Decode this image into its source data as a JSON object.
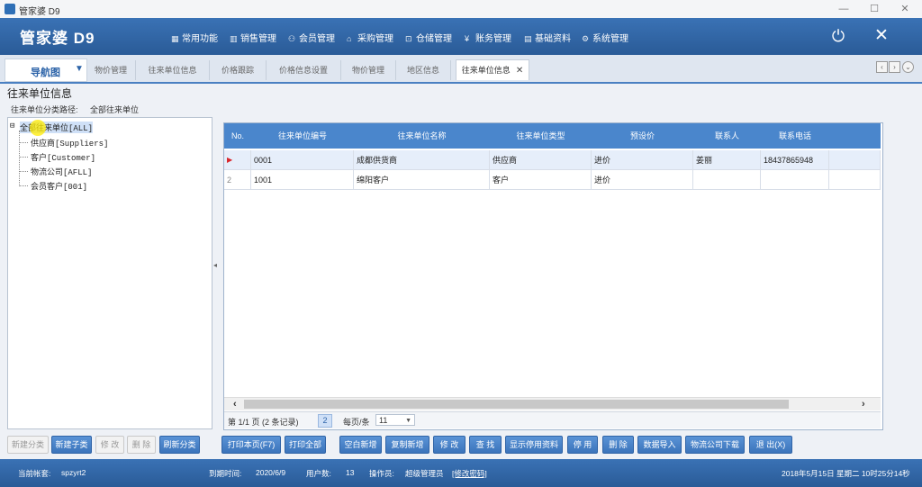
{
  "window": {
    "title": "管家婆 D9",
    "min": "—",
    "max": "☐",
    "close": "✕"
  },
  "header": {
    "logo": "管家婆 D9",
    "menu": [
      {
        "icon": "grid-icon",
        "glyph": "▦",
        "label": "常用功能"
      },
      {
        "icon": "chart-icon",
        "glyph": "▥",
        "label": "销售管理"
      },
      {
        "icon": "user-icon",
        "glyph": "⚇",
        "label": "会员管理"
      },
      {
        "icon": "home-icon",
        "glyph": "⌂",
        "label": "采购管理"
      },
      {
        "icon": "cart-icon",
        "glyph": "⊡",
        "label": "仓储管理"
      },
      {
        "icon": "yen-icon",
        "glyph": "¥",
        "label": "账务管理"
      },
      {
        "icon": "doc-icon",
        "glyph": "▤",
        "label": "基础资料"
      },
      {
        "icon": "gear-icon",
        "glyph": "⚙",
        "label": "系统管理"
      }
    ],
    "power_glyph": "⏻",
    "close_glyph": "✕"
  },
  "tabs": {
    "nav_label": "导航图",
    "items": [
      {
        "label": "物价管理"
      },
      {
        "label": "往来单位信息"
      },
      {
        "label": "价格跟踪"
      },
      {
        "label": "价格信息设置"
      },
      {
        "label": "物价管理"
      },
      {
        "label": "地区信息"
      },
      {
        "label": "往来单位信息",
        "active": true
      }
    ],
    "close_glyph": "✕"
  },
  "page": {
    "title": "往来单位信息",
    "path_label": "往来单位分类路径:",
    "path_value": "全部往来单位"
  },
  "tree": {
    "root": "全部往来单位[ALL]",
    "children": [
      "供应商[Suppliers]",
      "客户[Customer]",
      "物流公司[AFLL]",
      "会员客户[001]"
    ]
  },
  "grid": {
    "columns": [
      "No.",
      "往来单位编号",
      "往来单位名称",
      "往来单位类型",
      "预设价",
      "联系人",
      "联系电话"
    ],
    "rows": [
      {
        "no": "▶",
        "code": "0001",
        "name": "成都供货商",
        "type": "供应商",
        "price": "进价",
        "contact": "姜丽",
        "phone": "18437865948"
      },
      {
        "no": "2",
        "code": "1001",
        "name": "绵阳客户",
        "type": "客户",
        "price": "进价",
        "contact": "",
        "phone": ""
      }
    ],
    "pager": {
      "info": "第 1/1 页 (2 条记录)",
      "page": "2",
      "per_page_label": "每页/条",
      "per_page": "11"
    }
  },
  "left_buttons": [
    "新建分类",
    "新建子类",
    "修 改",
    "删 除",
    "刷新分类"
  ],
  "right_buttons": [
    "打印本页(F7)",
    "打印全部",
    "空白新增",
    "复制新增",
    "修 改",
    "查 找",
    "显示停用资料",
    "停 用",
    "删 除",
    "数据导入",
    "物流公司下载",
    "退 出(X)"
  ],
  "status": {
    "account_label": "当前帐套:",
    "account": "spzyrt2",
    "expire_label": "到期时间:",
    "expire": "2020/6/9",
    "users_label": "用户数:",
    "users": "13",
    "operator_label": "操作员:",
    "operator": "超级管理员",
    "change_pwd": "[修改密码]",
    "datetime": "2018年5月15日 星期二 10时25分14秒"
  },
  "colors": {
    "header": "#2f64a4",
    "accent": "#4a86cc",
    "row_arrow": "#d9262b"
  }
}
